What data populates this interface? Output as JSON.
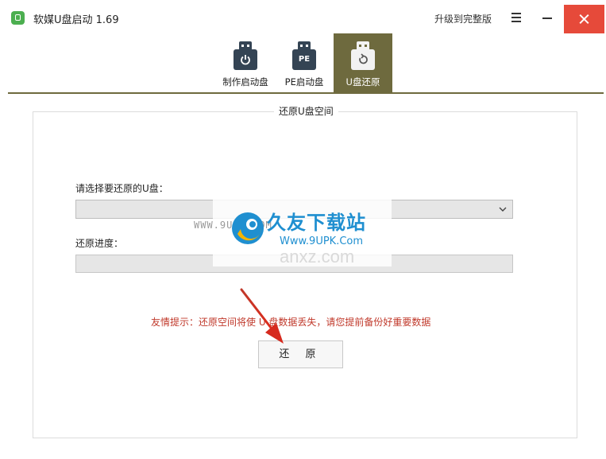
{
  "app": {
    "title": "软媒U盘启动 1.69",
    "upgrade_label": "升级到完整版"
  },
  "tabs": [
    {
      "label": "制作启动盘",
      "icon": "usb-power-icon",
      "active": false
    },
    {
      "label": "PE启动盘",
      "icon": "usb-pe-icon",
      "badge": "PE",
      "active": false
    },
    {
      "label": "U盘还原",
      "icon": "usb-restore-icon",
      "active": true
    }
  ],
  "panel": {
    "title": "还原U盘空间",
    "select_label": "请选择要还原的U盘：",
    "select_value": "",
    "progress_label": "还原进度：",
    "progress_percent": 0,
    "tip": "友情提示：还原空间将使 U 盘数据丢失，请您提前备份好重要数据",
    "restore_button": "还 原"
  },
  "watermark": {
    "left_text": "WWW.9UPK.COM",
    "brand": "久友下载站",
    "url": "Www.9UPK.Com",
    "faint": "anxz.com"
  },
  "colors": {
    "accent": "#6e6a3e",
    "close": "#e64a3a",
    "tip": "#c0392b",
    "watermark": "#1f8fd0",
    "arrow": "#d62a1e"
  }
}
